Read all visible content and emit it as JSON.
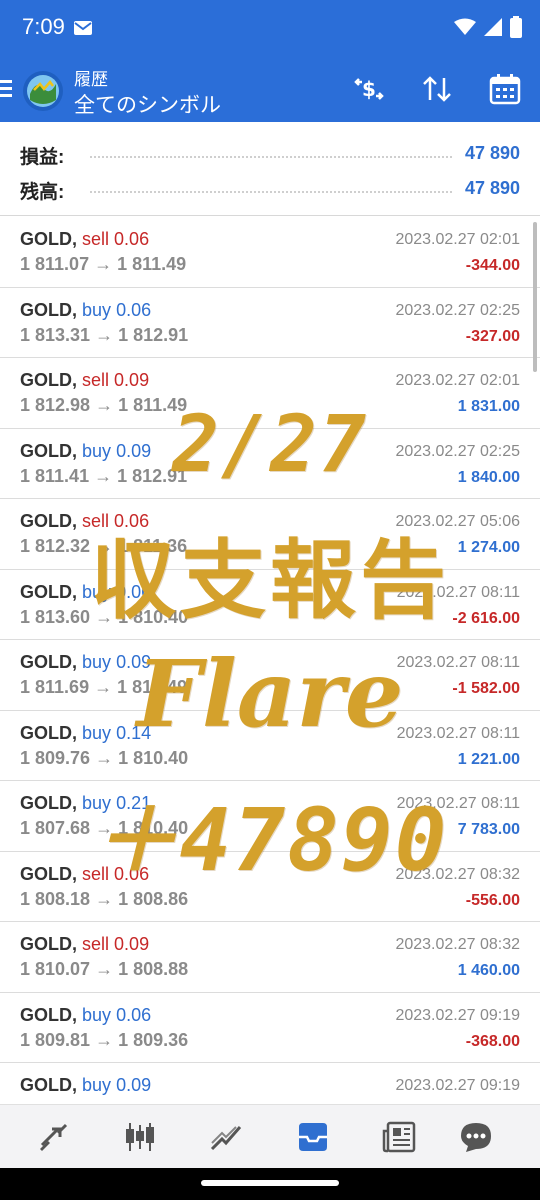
{
  "status": {
    "time": "7:09"
  },
  "app_bar": {
    "title": "履歴",
    "subtitle": "全てのシンボル"
  },
  "summary": {
    "profit_label": "損益:",
    "profit_value": "47 890",
    "balance_label": "残高:",
    "balance_value": "47 890"
  },
  "trades": [
    {
      "symbol": "GOLD,",
      "side": "sell",
      "volume": "0.06",
      "prices": "1 811.07 → 1 811.49",
      "time": "2023.02.27 02:01",
      "profit": "-344.00"
    },
    {
      "symbol": "GOLD,",
      "side": "buy",
      "volume": "0.06",
      "prices": "1 813.31 → 1 812.91",
      "time": "2023.02.27 02:25",
      "profit": "-327.00"
    },
    {
      "symbol": "GOLD,",
      "side": "sell",
      "volume": "0.09",
      "prices": "1 812.98 → 1 811.49",
      "time": "2023.02.27 02:01",
      "profit": "1 831.00"
    },
    {
      "symbol": "GOLD,",
      "side": "buy",
      "volume": "0.09",
      "prices": "1 811.41 → 1 812.91",
      "time": "2023.02.27 02:25",
      "profit": "1 840.00"
    },
    {
      "symbol": "GOLD,",
      "side": "sell",
      "volume": "0.06",
      "prices": "1 812.32 → 1 811.36",
      "time": "2023.02.27 05:06",
      "profit": "1 274.00"
    },
    {
      "symbol": "GOLD,",
      "side": "buy",
      "volume": "0.06",
      "prices": "1 813.60 → 1 810.40",
      "time": "2023.02.27 08:11",
      "profit": "-2 616.00"
    },
    {
      "symbol": "GOLD,",
      "side": "buy",
      "volume": "0.09",
      "prices": "1 811.69 → 1 810.49",
      "time": "2023.02.27 08:11",
      "profit": "-1 582.00"
    },
    {
      "symbol": "GOLD,",
      "side": "buy",
      "volume": "0.14",
      "prices": "1 809.76 → 1 810.40",
      "time": "2023.02.27 08:11",
      "profit": "1 221.00"
    },
    {
      "symbol": "GOLD,",
      "side": "buy",
      "volume": "0.21",
      "prices": "1 807.68 → 1 810.40",
      "time": "2023.02.27 08:11",
      "profit": "7 783.00"
    },
    {
      "symbol": "GOLD,",
      "side": "sell",
      "volume": "0.06",
      "prices": "1 808.18 → 1 808.86",
      "time": "2023.02.27 08:32",
      "profit": "-556.00"
    },
    {
      "symbol": "GOLD,",
      "side": "sell",
      "volume": "0.09",
      "prices": "1 810.07 → 1 808.88",
      "time": "2023.02.27 08:32",
      "profit": "1 460.00"
    },
    {
      "symbol": "GOLD,",
      "side": "buy",
      "volume": "0.06",
      "prices": "1 809.81 → 1 809.36",
      "time": "2023.02.27 09:19",
      "profit": "-368.00"
    },
    {
      "symbol": "GOLD,",
      "side": "buy",
      "volume": "0.09",
      "prices": "",
      "time": "2023.02.27 09:19",
      "profit": ""
    }
  ],
  "overlay": {
    "date": "2/27",
    "title": "収支報告",
    "name": "Flare",
    "amount": "＋47890"
  },
  "colors": {
    "app_bar": "#2b6ed8",
    "sell": "#c62828",
    "buy": "#2f6fd0",
    "overlay_gold": "#d4a12c"
  },
  "bottom_nav": [
    "quotes-icon",
    "chart-icon",
    "trade-icon",
    "history-icon",
    "news-icon",
    "chat-icon"
  ]
}
